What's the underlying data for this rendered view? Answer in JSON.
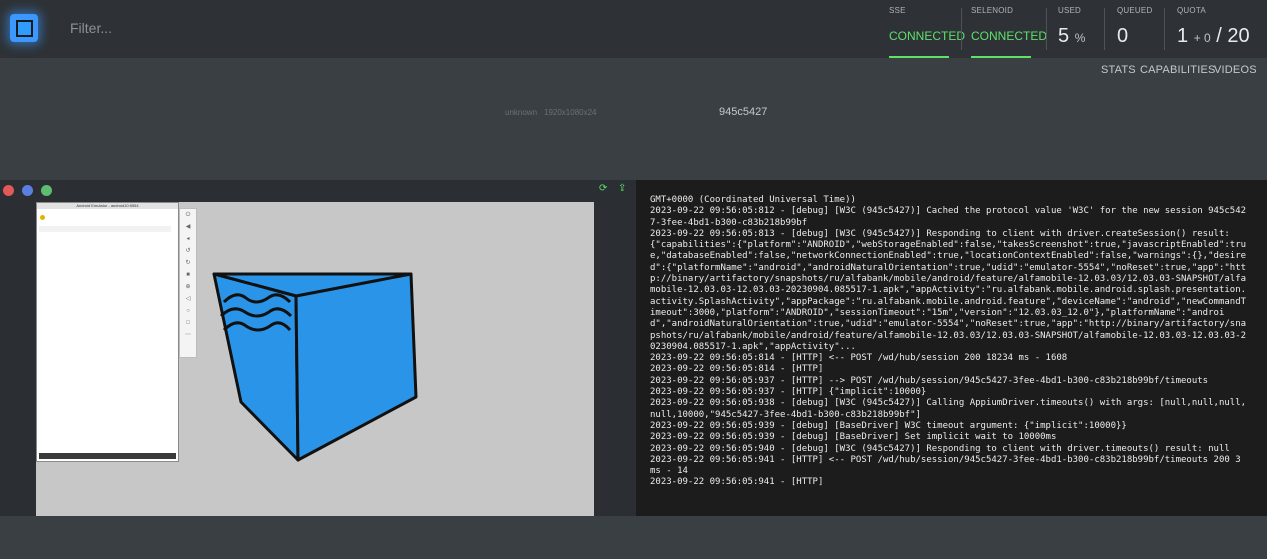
{
  "header": {
    "filter_placeholder": "Filter...",
    "sse": {
      "label": "SSE",
      "value": "CONNECTED"
    },
    "selenoid": {
      "label": "SELENOID",
      "value": "CONNECTED"
    },
    "used": {
      "label": "USED",
      "value": "5",
      "unit": "%"
    },
    "queued": {
      "label": "QUEUED",
      "value": "0"
    },
    "quota": {
      "label": "QUOTA",
      "value": "1",
      "plus": "+ 0",
      "total": "/ 20"
    },
    "accent_color": "#5ee06a",
    "logo_color": "#3b98ff"
  },
  "nav": {
    "stats": "STATS",
    "capabilities": "CAPABILITIES",
    "videos": "VIDEOS"
  },
  "session": {
    "browser": "unknown",
    "resolution": "1920x1080x24",
    "id": "945c5427"
  },
  "emulator": {
    "title": "Android Emulator - android10:5554"
  },
  "console": {
    "log": "GMT+0000 (Coordinated Universal Time))\n2023-09-22 09:56:05:812 - [debug] [W3C (945c5427)] Cached the protocol value 'W3C' for the new session 945c5427-3fee-4bd1-b300-c83b218b99bf\n2023-09-22 09:56:05:813 - [debug] [W3C (945c5427)] Responding to client with driver.createSession() result: {\"capabilities\":{\"platform\":\"ANDROID\",\"webStorageEnabled\":false,\"takesScreenshot\":true,\"javascriptEnabled\":true,\"databaseEnabled\":false,\"networkConnectionEnabled\":true,\"locationContextEnabled\":false,\"warnings\":{},\"desired\":{\"platformName\":\"android\",\"androidNaturalOrientation\":true,\"udid\":\"emulator-5554\",\"noReset\":true,\"app\":\"http://binary/artifactory/snapshots/ru/alfabank/mobile/android/feature/alfamobile-12.03.03/12.03.03-SNAPSHOT/alfamobile-12.03.03-12.03.03-20230904.085517-1.apk\",\"appActivity\":\"ru.alfabank.mobile.android.splash.presentation.activity.SplashActivity\",\"appPackage\":\"ru.alfabank.mobile.android.feature\",\"deviceName\":\"android\",\"newCommandTimeout\":3000,\"platform\":\"ANDROID\",\"sessionTimeout\":\"15m\",\"version\":\"12.03.03_12.0\"},\"platformName\":\"android\",\"androidNaturalOrientation\":true,\"udid\":\"emulator-5554\",\"noReset\":true,\"app\":\"http://binary/artifactory/snapshots/ru/alfabank/mobile/android/feature/alfamobile-12.03.03/12.03.03-SNAPSHOT/alfamobile-12.03.03-12.03.03-20230904.085517-1.apk\",\"appActivity\"...\n2023-09-22 09:56:05:814 - [HTTP] <-- POST /wd/hub/session 200 18234 ms - 1608\n2023-09-22 09:56:05:814 - [HTTP]\n2023-09-22 09:56:05:937 - [HTTP] --> POST /wd/hub/session/945c5427-3fee-4bd1-b300-c83b218b99bf/timeouts\n2023-09-22 09:56:05:937 - [HTTP] {\"implicit\":10000}\n2023-09-22 09:56:05:938 - [debug] [W3C (945c5427)] Calling AppiumDriver.timeouts() with args: [null,null,null,null,10000,\"945c5427-3fee-4bd1-b300-c83b218b99bf\"]\n2023-09-22 09:56:05:939 - [debug] [BaseDriver] W3C timeout argument: {\"implicit\":10000}}\n2023-09-22 09:56:05:939 - [debug] [BaseDriver] Set implicit wait to 10000ms\n2023-09-22 09:56:05:940 - [debug] [W3C (945c5427)] Responding to client with driver.timeouts() result: null\n2023-09-22 09:56:05:941 - [HTTP] <-- POST /wd/hub/session/945c5427-3fee-4bd1-b300-c83b218b99bf/timeouts 200 3 ms - 14\n2023-09-22 09:56:05:941 - [HTTP]"
  },
  "window_controls": {
    "close_color": "#e05a5a",
    "minimize_color": "#5a7fe0",
    "maximize_color": "#5ebd6e"
  }
}
